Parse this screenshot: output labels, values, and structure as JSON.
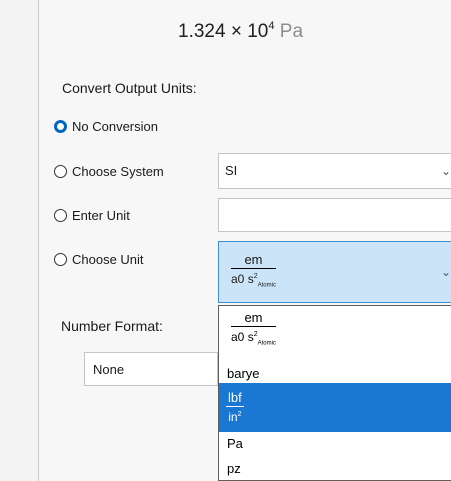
{
  "result": {
    "mantissa": "1.324",
    "times": "×",
    "base": "10",
    "exponent": "4",
    "unit": "Pa"
  },
  "convert": {
    "label": "Convert Output Units:",
    "options": [
      "No Conversion",
      "Choose System",
      "Enter Unit",
      "Choose Unit"
    ],
    "selected": "No Conversion",
    "system_value": "SI",
    "enter_unit_value": "",
    "unit_value": {
      "numerator": "em",
      "denominator": "a0",
      "den_s": "s",
      "den_sup": "2",
      "den_sub": "Atomic"
    }
  },
  "dropdown": {
    "items": [
      {
        "numerator": "em",
        "denominator": "a0",
        "den_s": "s",
        "den_sup": "2",
        "den_sub": "Atomic"
      },
      {
        "text": "barye"
      },
      {
        "numerator": "lbf",
        "denominator": "in",
        "den_sup": "2",
        "selected": true
      },
      {
        "text": "Pa"
      },
      {
        "text": "pz"
      }
    ]
  },
  "number_format": {
    "label": "Number Format:",
    "value": "None"
  },
  "icons": {
    "chevron": "chevron-down-icon"
  },
  "colors": {
    "accent": "#0067c0",
    "highlight": "#1a78d4",
    "combo_focus_bg": "#cce4f7"
  }
}
